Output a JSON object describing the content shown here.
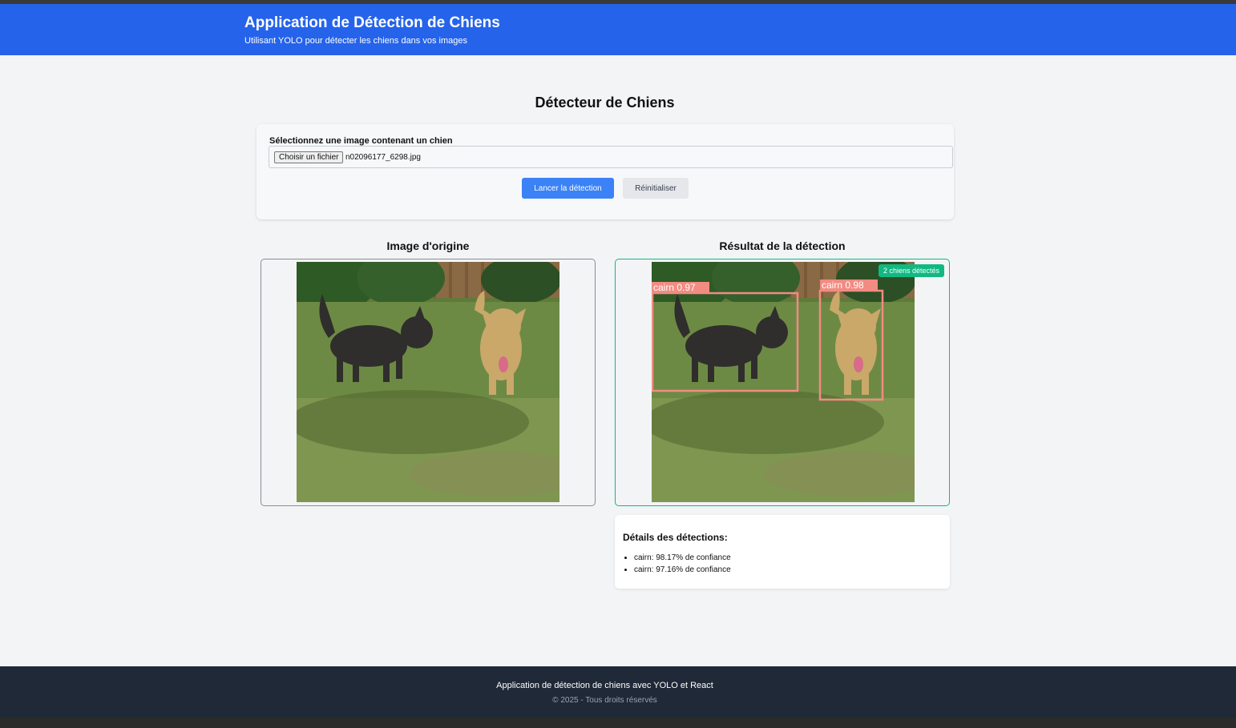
{
  "header": {
    "title": "Application de Détection de Chiens",
    "subtitle": "Utilisant YOLO pour détecter les chiens dans vos images"
  },
  "main": {
    "page_title": "Détecteur de Chiens",
    "upload": {
      "label": "Sélectionnez une image contenant un chien",
      "file_button": "Choisir un fichier",
      "file_name": "n02096177_6298.jpg",
      "detect_button": "Lancer la détection",
      "reset_button": "Réinitialiser"
    },
    "original_panel": {
      "heading": "Image d'origine"
    },
    "result_panel": {
      "heading": "Résultat de la détection",
      "badge": "2 chiens détectés",
      "boxes": [
        {
          "label": "cairn 0.97"
        },
        {
          "label": "cairn 0.98"
        }
      ]
    },
    "details": {
      "title": "Détails des détections:",
      "items": [
        "cairn: 98.17% de confiance",
        "cairn: 97.16% de confiance"
      ]
    }
  },
  "footer": {
    "line1": "Application de détection de chiens avec YOLO et React",
    "line2": "© 2025 - Tous droits réservés"
  },
  "colors": {
    "header_bg": "#2563eb",
    "primary_button": "#3b82f6",
    "success": "#10b981",
    "box_color": "#f28b82",
    "footer_bg": "#1f2937"
  }
}
